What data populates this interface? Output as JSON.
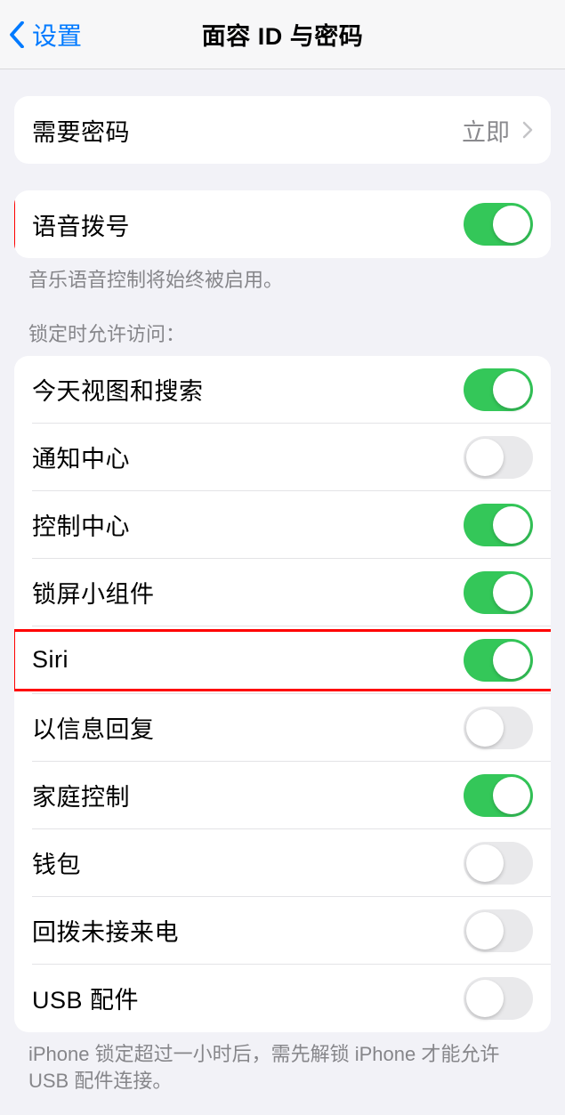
{
  "nav": {
    "back_label": "设置",
    "title": "面容 ID 与密码"
  },
  "require_passcode": {
    "label": "需要密码",
    "value": "立即"
  },
  "voice_dial": {
    "label": "语音拨号",
    "on": true,
    "footer": "音乐语音控制将始终被启用。"
  },
  "lock_access": {
    "header": "锁定时允许访问：",
    "items": [
      {
        "label": "今天视图和搜索",
        "on": true
      },
      {
        "label": "通知中心",
        "on": false
      },
      {
        "label": "控制中心",
        "on": true
      },
      {
        "label": "锁屏小组件",
        "on": true
      },
      {
        "label": "Siri",
        "on": true
      },
      {
        "label": "以信息回复",
        "on": false
      },
      {
        "label": "家庭控制",
        "on": true
      },
      {
        "label": "钱包",
        "on": false
      },
      {
        "label": "回拨未接来电",
        "on": false
      },
      {
        "label": "USB 配件",
        "on": false
      }
    ],
    "footer": "iPhone 锁定超过一小时后，需先解锁 iPhone 才能允许USB 配件连接。"
  }
}
